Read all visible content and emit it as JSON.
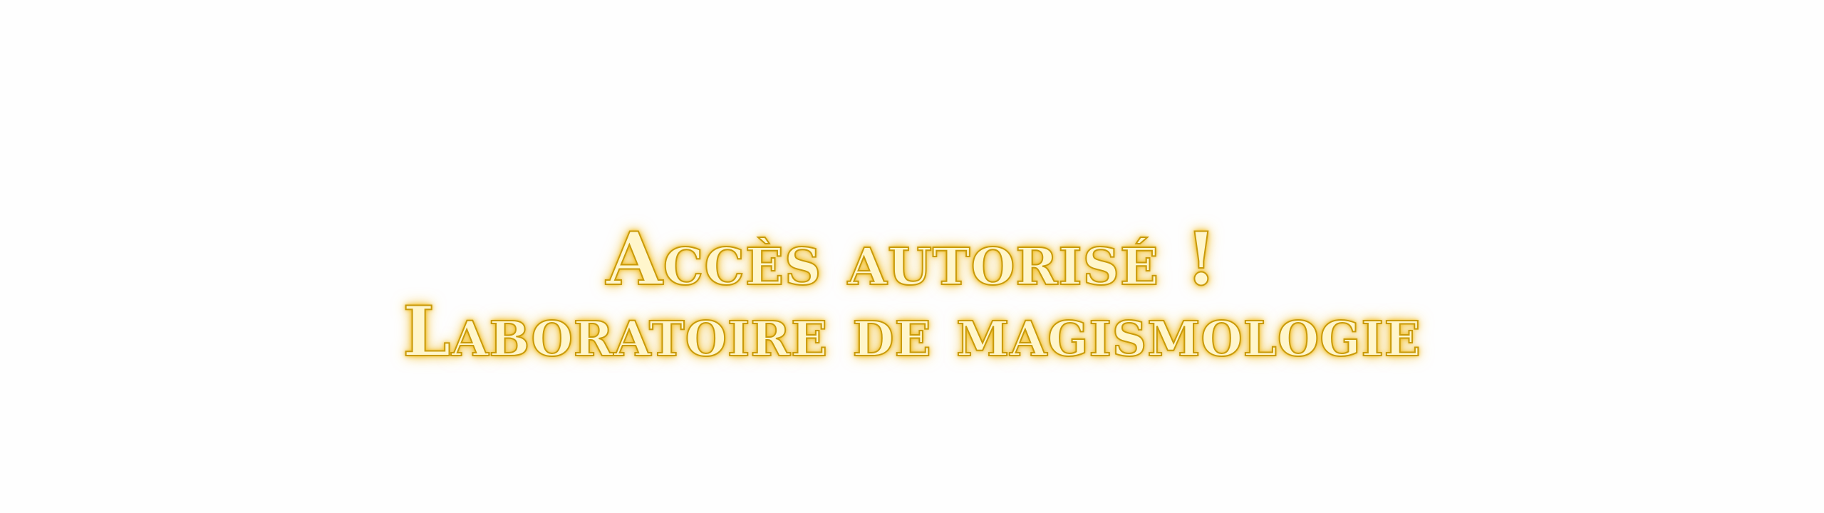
{
  "notification": {
    "line1": "Accès autorisé !",
    "line2": "Laboratoire de magismologie"
  },
  "colors": {
    "background": "#fefefe",
    "text_fill": "#fff6cc",
    "text_outline": "#c99a0a",
    "glow": "#f2c94c"
  }
}
